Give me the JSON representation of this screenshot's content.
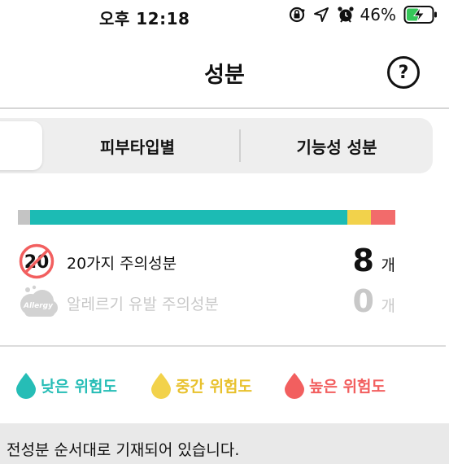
{
  "status_bar": {
    "time": "오후 12:18",
    "battery_percent": "46%",
    "icons": [
      "orientation-lock-icon",
      "location-arrow-icon",
      "alarm-icon",
      "battery-charging-icon"
    ]
  },
  "header": {
    "title": "성분",
    "help_label": "?"
  },
  "tabs": {
    "items": [
      "",
      "피부타입별",
      "기능성 성분"
    ],
    "selected_index": 0
  },
  "risk_bar": {
    "segments": [
      {
        "name": "unknown",
        "fraction": 0.033,
        "color": "#c4c4c4"
      },
      {
        "name": "low",
        "fraction": 0.84,
        "color": "#1cbbb4"
      },
      {
        "name": "medium",
        "fraction": 0.063,
        "color": "#f2d24b"
      },
      {
        "name": "high",
        "fraction": 0.064,
        "color": "#f26b6b"
      }
    ]
  },
  "ingredients": {
    "caution20": {
      "icon_text": "20",
      "label": "20가지 주의성분",
      "count": "8",
      "unit": "개"
    },
    "allergy": {
      "icon_text": "Allergy",
      "label": "알레르기 유발 주의성분",
      "count": "0",
      "unit": "개"
    }
  },
  "legend": {
    "low": {
      "label": "낮은 위험도",
      "color": "#26bdb6"
    },
    "medium": {
      "label": "중간 위험도",
      "color": "#e8c12d"
    },
    "high": {
      "label": "높은 위험도",
      "color": "#f25f5f"
    }
  },
  "footer": {
    "note": "전성분 순서대로 기재되어 있습니다."
  }
}
